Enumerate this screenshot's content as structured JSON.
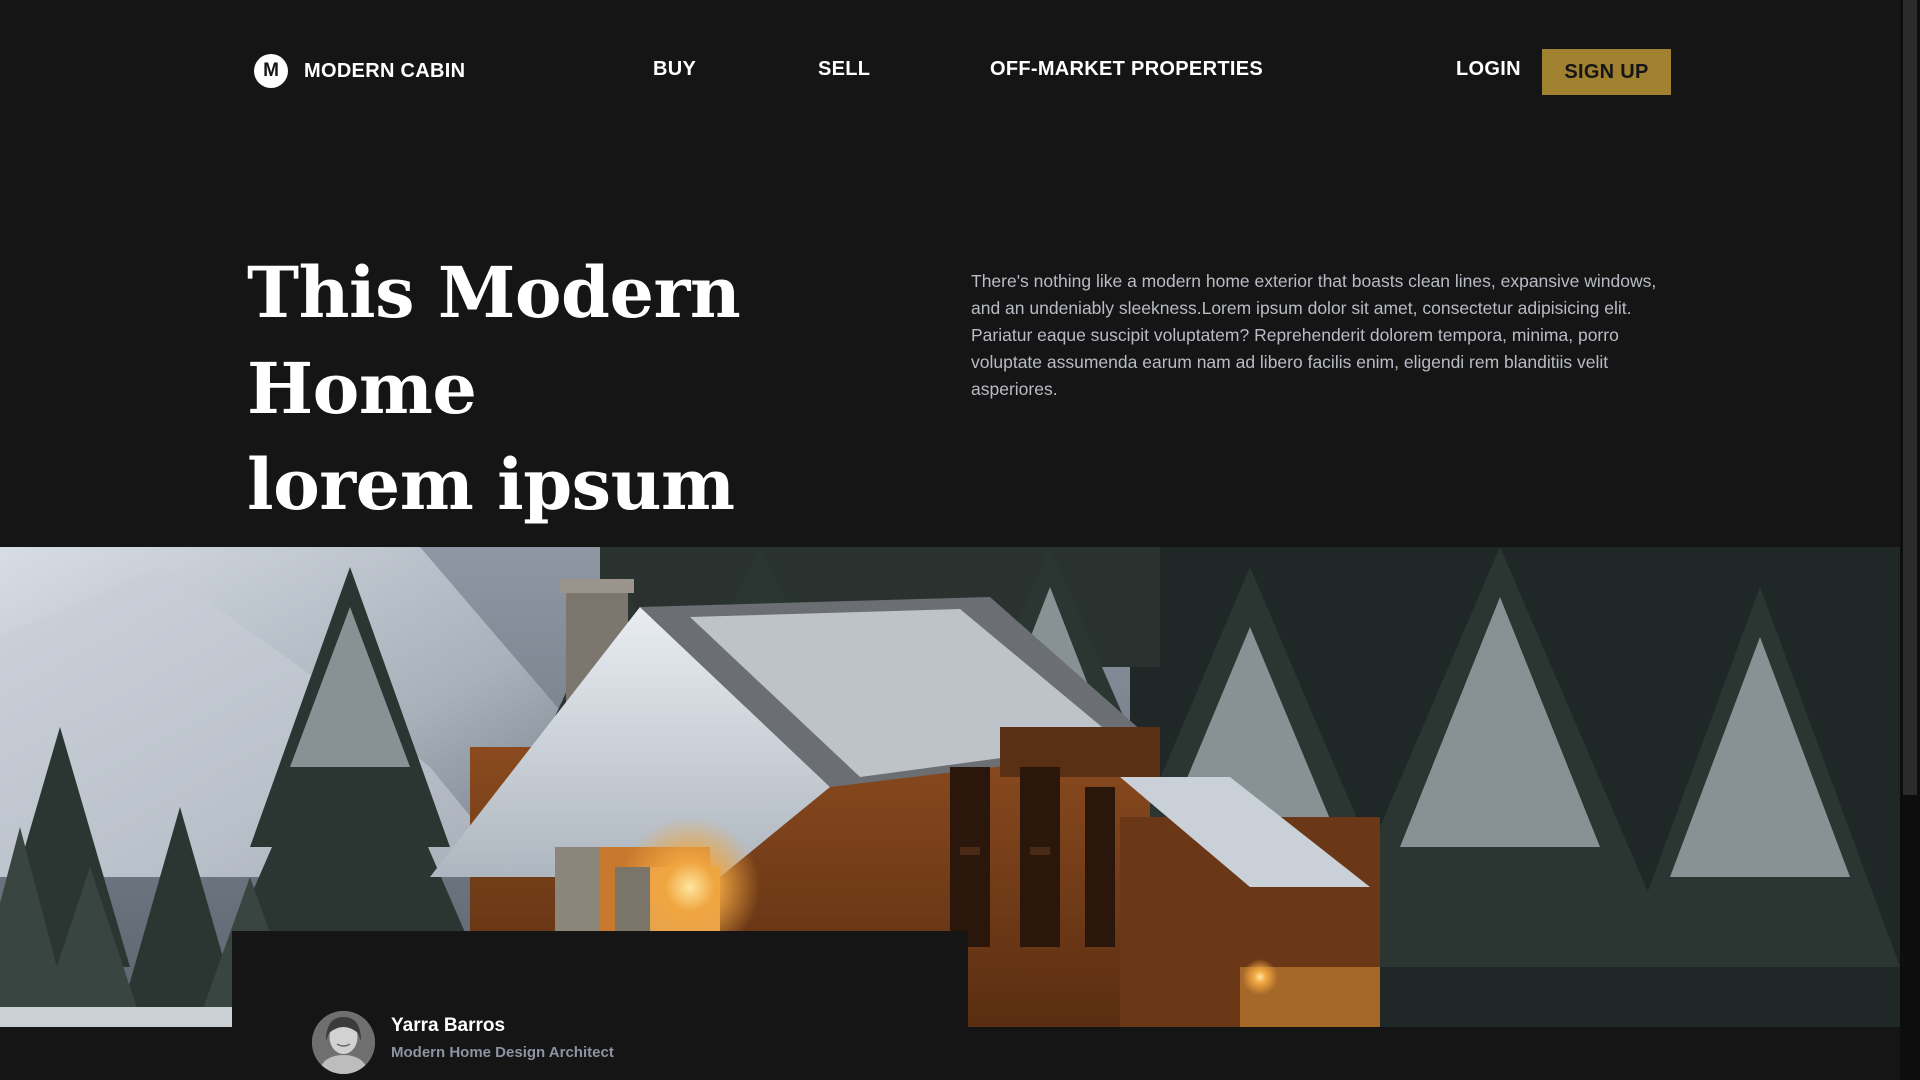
{
  "brand": {
    "logo_letter": "M",
    "name": "MODERN CABIN"
  },
  "nav": {
    "buy": "BUY",
    "sell": "SELL",
    "off_market": "OFF-MARKET PROPERTIES",
    "login": "LOGIN",
    "signup": "SIGN UP"
  },
  "hero": {
    "title_line1": "This Modern Home",
    "title_line2": "lorem ipsum",
    "description": "There's nothing like a modern home exterior that boasts clean lines, expansive windows, and an undeniably sleekness.Lorem ipsum dolor sit amet, consectetur adipisicing elit. Pariatur eaque suscipit voluptatem? Reprehenderit dolorem tempora, minima, porro voluptate assumenda earum nam ad libero facilis enim, eligendi rem blanditiis velit asperiores."
  },
  "author": {
    "name": "Yarra Barros",
    "role": "Modern Home Design Architect"
  },
  "colors": {
    "background": "#151516",
    "accent": "#a0812f",
    "body_text": "#b9bcc4",
    "muted": "#8d93a3"
  },
  "icons": {
    "brand": "brand-logo-icon",
    "avatar": "avatar-photo"
  }
}
